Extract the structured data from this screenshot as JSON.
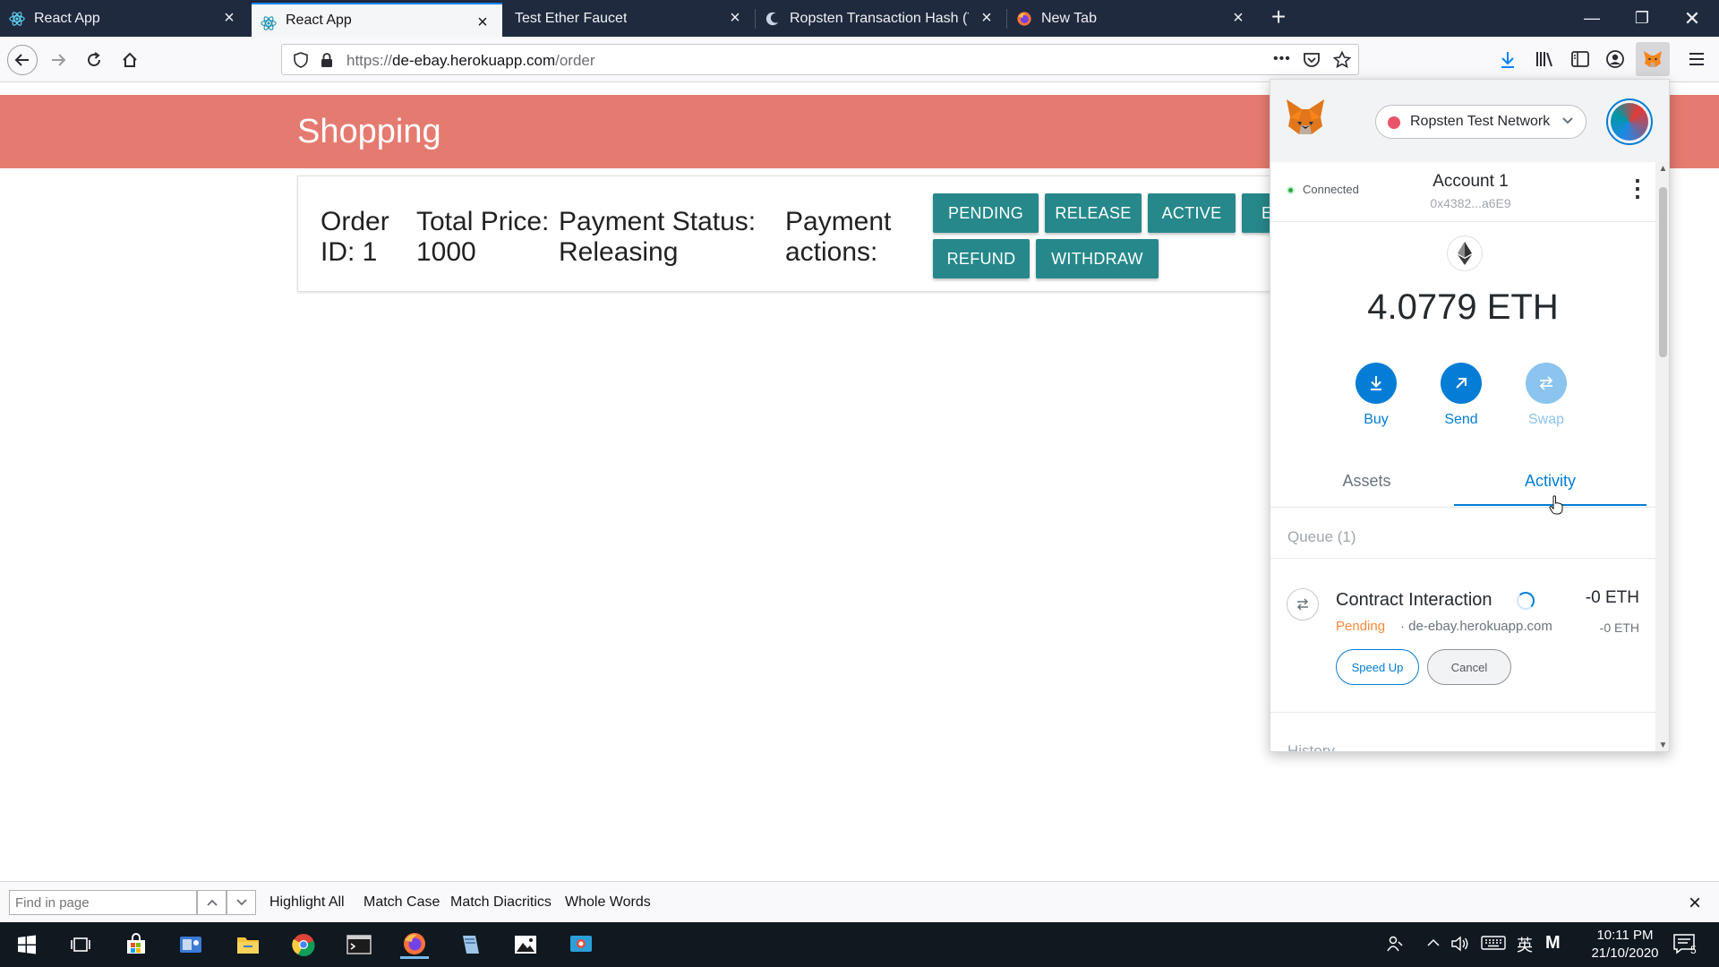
{
  "browser": {
    "tabs": [
      {
        "label": "React App",
        "active": false
      },
      {
        "label": "React App",
        "active": true
      },
      {
        "label": "Test Ether Faucet",
        "active": false
      },
      {
        "label": "Ropsten Transaction Hash (Txh",
        "active": false
      },
      {
        "label": "New Tab",
        "active": false
      }
    ],
    "url_prefix": "https://",
    "url_host": "de-ebay.herokuapp.com",
    "url_path": "/order",
    "more_label": "•••"
  },
  "page": {
    "title": "Shopping",
    "order": {
      "id_label": "Order ID: 1",
      "total_label": "Total Price: 1000",
      "status_label": "Payment Status: Releasing",
      "actions_label": "Payment actions:"
    },
    "buttons": [
      "PENDING",
      "RELEASE",
      "ACTIVE",
      "E",
      "REFUND",
      "WITHDRAW"
    ]
  },
  "findbar": {
    "placeholder": "Find in page",
    "options": [
      "Highlight All",
      "Match Case",
      "Match Diacritics",
      "Whole Words"
    ]
  },
  "taskbar": {
    "time": "10:11 PM",
    "date": "21/10/2020",
    "lang": "英",
    "ime": "M",
    "notifications": "5"
  },
  "metamask": {
    "network": "Ropsten Test Network",
    "connection": "Connected",
    "account_name": "Account 1",
    "account_address": "0x4382...a6E9",
    "balance": "4.0779 ETH",
    "actions": {
      "buy": "Buy",
      "send": "Send",
      "swap": "Swap"
    },
    "tabs": {
      "assets": "Assets",
      "activity": "Activity"
    },
    "queue_label": "Queue (1)",
    "transaction": {
      "title": "Contract Interaction",
      "status": "Pending",
      "origin": "· de-ebay.herokuapp.com",
      "amount": "-0 ETH",
      "sub_amount": "-0 ETH",
      "speed_up": "Speed Up",
      "cancel": "Cancel"
    },
    "history_label": "History"
  },
  "colors": {
    "header": "#e57b70",
    "button_teal": "#26888a",
    "mm_blue": "#037dd6",
    "pending_orange": "#f8883b"
  }
}
